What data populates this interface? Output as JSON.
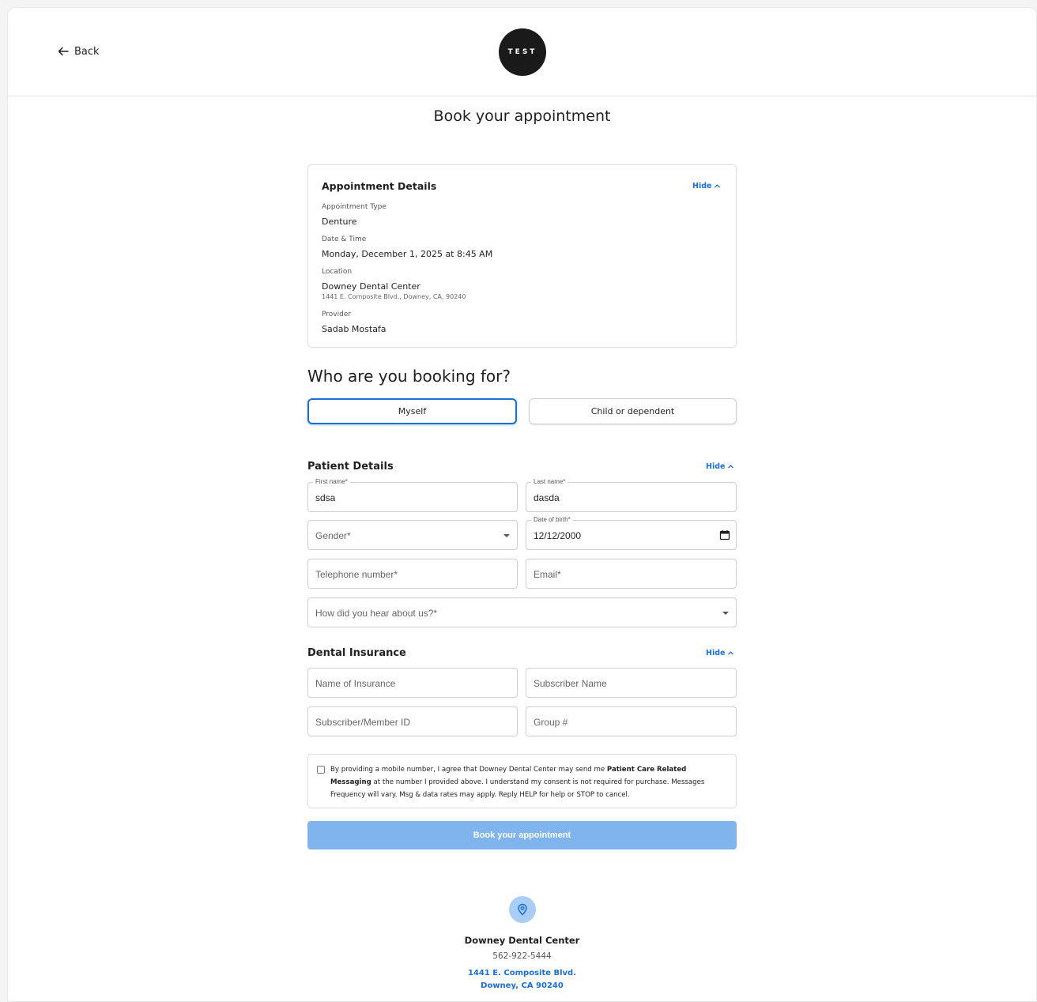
{
  "header": {
    "back_label": "Back",
    "logo_text": "TEST"
  },
  "page_title": "Book your appointment",
  "appointment_details": {
    "title": "Appointment Details",
    "hide_label": "Hide",
    "type_label": "Appointment Type",
    "type_value": "Denture",
    "datetime_label": "Date & Time",
    "datetime_value": "Monday, December 1, 2025 at 8:45 AM",
    "location_label": "Location",
    "location_name": "Downey Dental Center",
    "location_address": "1441 E. Composite Blvd., Downey, CA, 90240",
    "provider_label": "Provider",
    "provider_value": "Sadab Mostafa"
  },
  "booking_for": {
    "title": "Who are you booking for?",
    "options": [
      "Myself",
      "Child or dependent"
    ],
    "selected": "Myself"
  },
  "patient_details": {
    "title": "Patient Details",
    "hide_label": "Hide",
    "first_name_label": "First name*",
    "first_name_value": "sdsa",
    "last_name_label": "Last name*",
    "last_name_value": "dasda",
    "gender_placeholder": "Gender*",
    "dob_label": "Date of birth*",
    "dob_value": "12/12/2000",
    "telephone_placeholder": "Telephone number*",
    "email_placeholder": "Email*",
    "referral_placeholder": "How did you hear about us?*"
  },
  "dental_insurance": {
    "title": "Dental Insurance",
    "hide_label": "Hide",
    "insurance_name_placeholder": "Name of Insurance",
    "subscriber_name_placeholder": "Subscriber Name",
    "member_id_placeholder": "Subscriber/Member ID",
    "group_placeholder": "Group #"
  },
  "consent": {
    "text_before": "By providing a mobile number, I agree that Downey Dental Center may send me ",
    "text_bold": "Patient Care Related Messaging",
    "text_after": " at the number I provided above. I understand my consent is not required for purchase. Messages Frequency will vary. Msg & data rates may apply. Reply HELP for help or STOP to cancel.",
    "checked": false
  },
  "submit_label": "Book your appointment",
  "footer": {
    "name": "Downey Dental Center",
    "phone": "562-922-5444",
    "address_line1": "1441 E. Composite Blvd.",
    "address_line2": "Downey, CA 90240"
  },
  "colors": {
    "accent": "#1a6fd1",
    "button_disabled": "#7fb4ec",
    "pin_bg": "#a9cdf4"
  }
}
